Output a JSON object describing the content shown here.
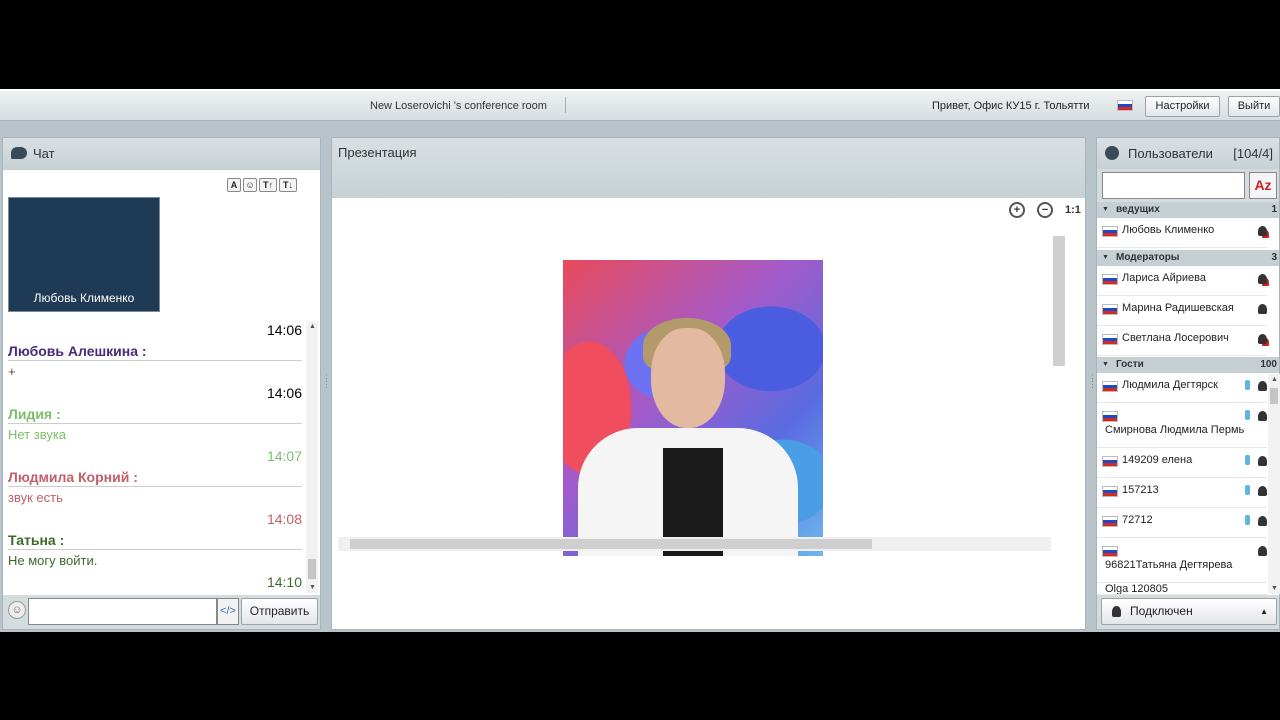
{
  "topbar": {
    "room_title": "New Loserovichi 's conference room",
    "greeting": "Привет, Офис КУ15 г. Тольятти",
    "settings_label": "Настройки",
    "exit_label": "Выйти"
  },
  "chat": {
    "title": "Чат",
    "format_buttons": [
      "A",
      "☺",
      "T↑",
      "T↓"
    ],
    "video_name": "Любовь Клименко",
    "messages": [
      {
        "time": "14:06",
        "author": "Любовь Алешкина :",
        "text": "+",
        "color": "#4a2a7a"
      },
      {
        "time": "14:06",
        "author": "Лидия :",
        "text": "Нет звука",
        "color": "#7cbf6a"
      },
      {
        "time": "14:07",
        "author": "Людмила Корний :",
        "text": "звук есть",
        "color": "#c0606a"
      },
      {
        "time": "14:08",
        "author": "Татьна :",
        "text": "Не могу войти.",
        "color": "#3d6a2a"
      }
    ],
    "last_time": "14:10",
    "code_button": "</>",
    "send_label": "Отправить"
  },
  "presentation": {
    "title": "Презентация",
    "zoom_reset": "1:1"
  },
  "users": {
    "title": "Пользователи",
    "count": "[104/4]",
    "sort_label": "Az",
    "groups": [
      {
        "name": "ведущих",
        "count": "1"
      },
      {
        "name": "Модераторы",
        "count": "3"
      },
      {
        "name": "Гости",
        "count": "100"
      }
    ],
    "presenters": [
      "Любовь Клименко"
    ],
    "moderators": [
      "Лариса Айриева",
      "Марина Радишевская",
      "Светлана Лосерович"
    ],
    "guests": [
      "Людмила Дегтярск",
      "Смирнова Людмила Пермь",
      "149209 елена",
      "157213",
      "72712",
      "96821Татьяна Дегтярева",
      "Olga 120805"
    ],
    "status_label": "Подключен"
  }
}
